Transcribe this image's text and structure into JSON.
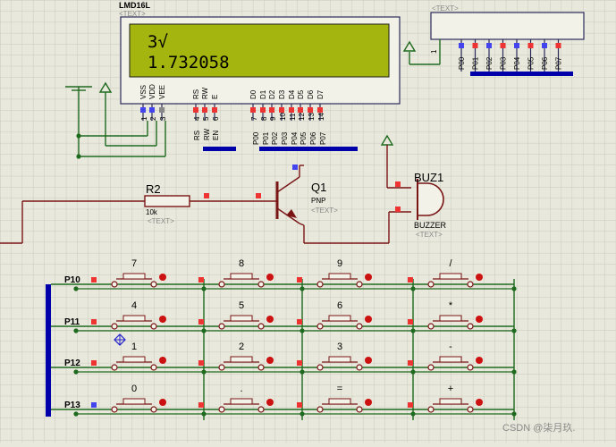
{
  "lcd": {
    "part": "LMD16L",
    "text_tag": "<TEXT>",
    "line1": "3√",
    "line2": "1.732058",
    "pins": [
      {
        "num": "1",
        "name": "VSS"
      },
      {
        "num": "2",
        "name": "VDD"
      },
      {
        "num": "3",
        "name": "VEE"
      },
      {
        "num": "4",
        "name": "RS"
      },
      {
        "num": "5",
        "name": "RW"
      },
      {
        "num": "6",
        "name": "E"
      },
      {
        "num": "7",
        "name": "D0"
      },
      {
        "num": "8",
        "name": "D1"
      },
      {
        "num": "9",
        "name": "D2"
      },
      {
        "num": "10",
        "name": "D3"
      },
      {
        "num": "11",
        "name": "D4"
      },
      {
        "num": "12",
        "name": "D5"
      },
      {
        "num": "13",
        "name": "D6"
      },
      {
        "num": "14",
        "name": "D7"
      }
    ],
    "ctrl_nets": [
      "RS",
      "RW",
      "EN"
    ],
    "data_nets": [
      "P00",
      "P01",
      "P02",
      "P03",
      "P04",
      "P05",
      "P06",
      "P07"
    ]
  },
  "header": {
    "text_tag": "<TEXT>",
    "pin1": "1",
    "nets": [
      "P00",
      "P01",
      "P02",
      "P03",
      "P04",
      "P05",
      "P06",
      "P07"
    ]
  },
  "resistor": {
    "ref": "R2",
    "value": "10k",
    "text_tag": "<TEXT>"
  },
  "transistor": {
    "ref": "Q1",
    "type": "PNP",
    "text_tag": "<TEXT>"
  },
  "buzzer": {
    "ref": "BUZ1",
    "type": "BUZZER",
    "text_tag": "<TEXT>"
  },
  "keypad": {
    "rows": [
      "P10",
      "P11",
      "P12",
      "P13"
    ],
    "keys": [
      [
        "7",
        "8",
        "9",
        "/"
      ],
      [
        "4",
        "5",
        "6",
        "*"
      ],
      [
        "1",
        "2",
        "3",
        "-"
      ],
      [
        "0",
        ".",
        "=",
        "+"
      ]
    ]
  },
  "watermark": "CSDN @柒月玖."
}
